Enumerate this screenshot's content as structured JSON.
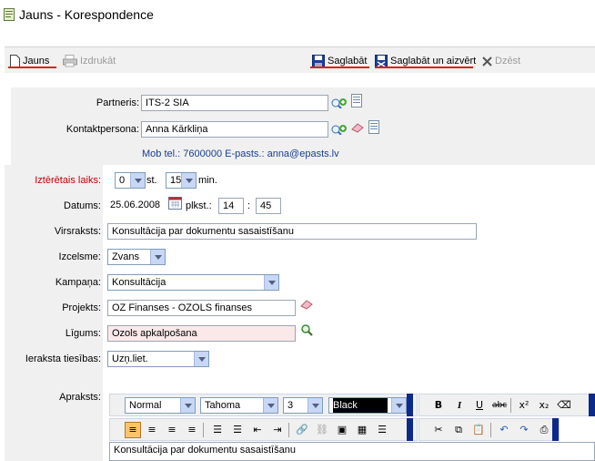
{
  "window": {
    "title": "Jauns - Korespondence"
  },
  "toolbar": {
    "new_label": "Jauns",
    "print_label": "Izdrukāt",
    "save_label": "Saglabāt",
    "save_close_label": "Saglabāt un aizvērt",
    "delete_label": "Dzēst"
  },
  "partner": {
    "partner_label": "Partneris:",
    "partner_value": "ITS-2 SIA",
    "contact_label": "Kontaktpersona:",
    "contact_value": "Anna Kārkliņa",
    "contact_info": "Mob tel.: 7600000  E-pasts.: anna@epasts.lv"
  },
  "form": {
    "time_label": "Iztērētais laiks:",
    "hours_value": "0",
    "hours_unit": "st.",
    "minutes_value": "15",
    "minutes_unit": "min.",
    "date_label": "Datums:",
    "date_value": "25.06.2008",
    "time_at_label": "plkst.:",
    "hour_value": "14",
    "colon": ":",
    "minute_value": "45",
    "heading_label": "Virsraksts:",
    "heading_value": "Konsultācija par  dokumentu sasaistīšanu",
    "source_label": "Izcelsme:",
    "source_value": "Zvans",
    "campaign_label": "Kampaņa:",
    "campaign_value": "Konsultācija",
    "project_label": "Projekts:",
    "project_value": "OZ Finanses - OZOLS finanses",
    "contract_label": "Līgums:",
    "contract_value": "Ozols apkalpošana",
    "rights_label": "Ieraksta tiesības:",
    "rights_value": "Uzņ.liet.",
    "description_label": "Apraksts:"
  },
  "editor": {
    "style_value": "Normal",
    "font_value": "Tahoma",
    "size_value": "3",
    "color_value": "Black",
    "content": "Konsultācija par  dokumentu sasaistīšanu"
  }
}
